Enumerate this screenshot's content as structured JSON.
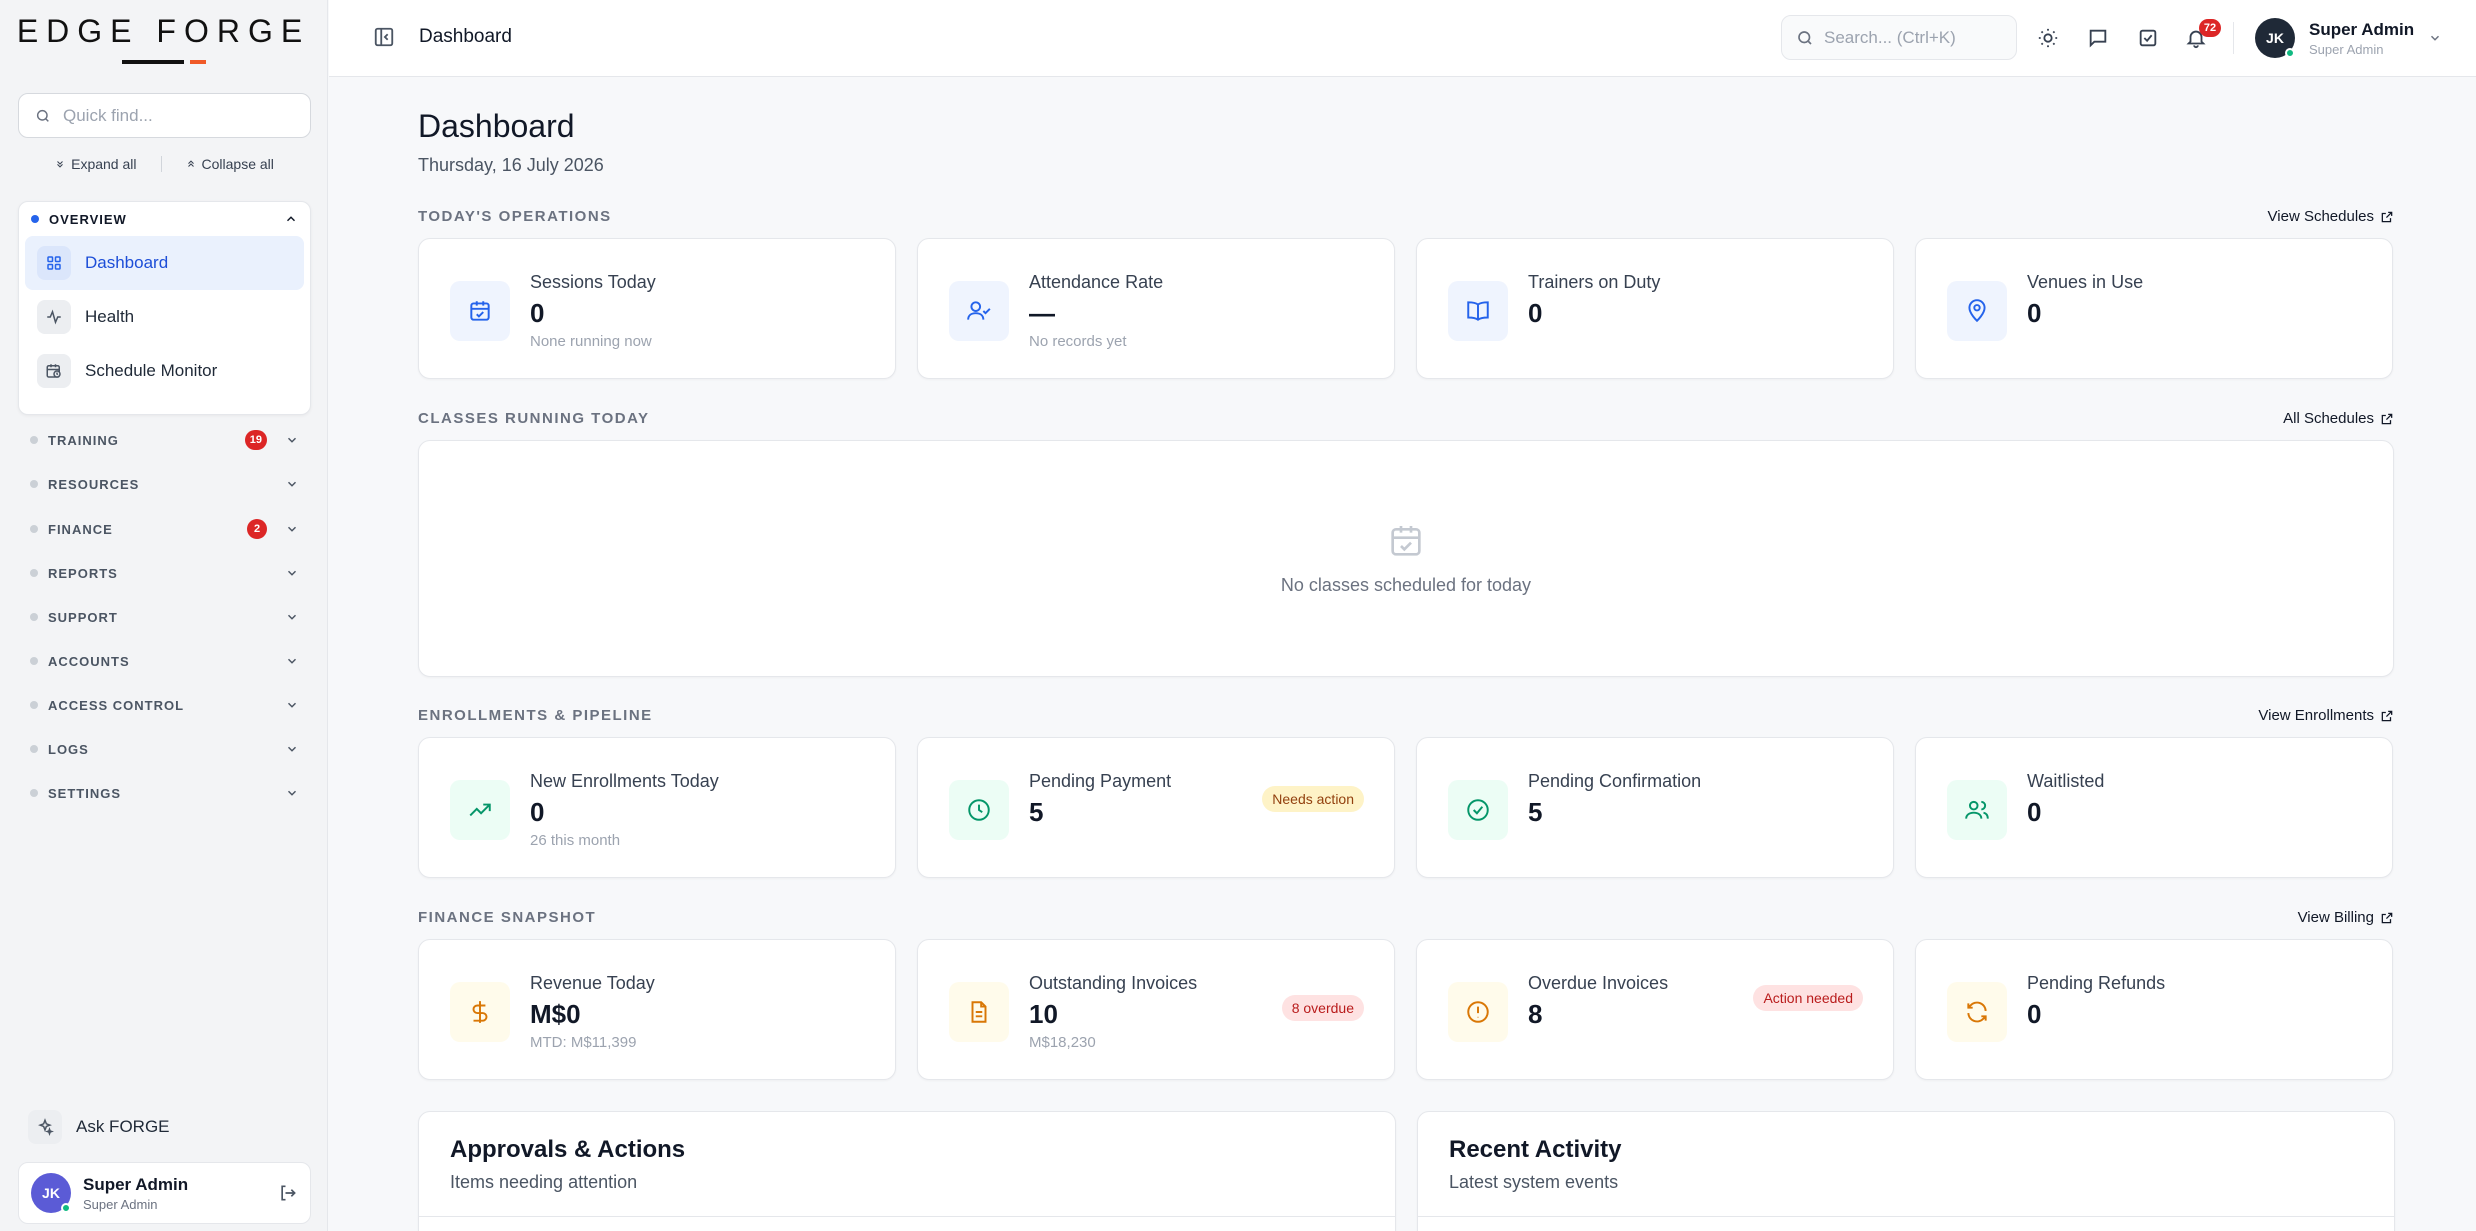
{
  "brand": {
    "logo_text": "EDGE FORGE"
  },
  "sidebar": {
    "quick_find_placeholder": "Quick find...",
    "expand_all": "Expand all",
    "collapse_all": "Collapse all",
    "overview": {
      "label": "OVERVIEW",
      "items": [
        {
          "label": "Dashboard",
          "icon": "grid-icon",
          "active": true
        },
        {
          "label": "Health",
          "icon": "pulse-icon"
        },
        {
          "label": "Schedule Monitor",
          "icon": "calendar-clock-icon"
        }
      ]
    },
    "groups": [
      {
        "label": "TRAINING",
        "badge": "19"
      },
      {
        "label": "RESOURCES"
      },
      {
        "label": "FINANCE",
        "badge": "2"
      },
      {
        "label": "REPORTS"
      },
      {
        "label": "SUPPORT"
      },
      {
        "label": "ACCOUNTS"
      },
      {
        "label": "ACCESS CONTROL"
      },
      {
        "label": "LOGS"
      },
      {
        "label": "SETTINGS"
      }
    ],
    "ask_label": "Ask FORGE",
    "user": {
      "initials": "JK",
      "name": "Super Admin",
      "role": "Super Admin"
    }
  },
  "topbar": {
    "title": "Dashboard",
    "search_placeholder": "Search... (Ctrl+K)",
    "notifications_count": "72",
    "user": {
      "initials": "JK",
      "name": "Super Admin",
      "role": "Super Admin"
    }
  },
  "page": {
    "title": "Dashboard",
    "date": "Thursday, 16 July 2026"
  },
  "operations": {
    "title": "TODAY'S OPERATIONS",
    "link": "View Schedules",
    "cards": [
      {
        "label": "Sessions Today",
        "value": "0",
        "sub": "None running now",
        "icon": "calendar-check-icon"
      },
      {
        "label": "Attendance Rate",
        "value": "—",
        "sub": "No records yet",
        "icon": "user-check-icon"
      },
      {
        "label": "Trainers on Duty",
        "value": "0",
        "sub": "",
        "icon": "book-open-icon"
      },
      {
        "label": "Venues in Use",
        "value": "0",
        "sub": "",
        "icon": "map-pin-icon"
      }
    ]
  },
  "classes": {
    "title": "CLASSES RUNNING TODAY",
    "link": "All Schedules",
    "empty_text": "No classes scheduled for today"
  },
  "enrollments": {
    "title": "ENROLLMENTS & PIPELINE",
    "link": "View Enrollments",
    "cards": [
      {
        "label": "New Enrollments Today",
        "value": "0",
        "sub": "26 this month",
        "icon": "trending-up-icon"
      },
      {
        "label": "Pending Payment",
        "value": "5",
        "sub": "",
        "pill": "Needs action",
        "icon": "clock-icon"
      },
      {
        "label": "Pending Confirmation",
        "value": "5",
        "sub": "",
        "icon": "check-circle-icon"
      },
      {
        "label": "Waitlisted",
        "value": "0",
        "sub": "",
        "icon": "users-icon"
      }
    ]
  },
  "finance": {
    "title": "FINANCE SNAPSHOT",
    "link": "View Billing",
    "cards": [
      {
        "label": "Revenue Today",
        "value": "M$0",
        "sub": "MTD: M$11,399",
        "icon": "dollar-icon"
      },
      {
        "label": "Outstanding Invoices",
        "value": "10",
        "sub": "M$18,230",
        "pill": "8 overdue",
        "icon": "file-text-icon"
      },
      {
        "label": "Overdue Invoices",
        "value": "8",
        "sub": "",
        "pill": "Action needed",
        "icon": "alert-circle-icon"
      },
      {
        "label": "Pending Refunds",
        "value": "0",
        "sub": "",
        "icon": "refresh-icon"
      }
    ]
  },
  "approvals": {
    "title": "Approvals & Actions",
    "subtitle": "Items needing attention"
  },
  "activity": {
    "title": "Recent Activity",
    "subtitle": "Latest system events"
  },
  "colors": {
    "accent": "#2563eb",
    "brand_orange": "#f05a28",
    "danger": "#dc2626",
    "success": "#10b981"
  }
}
